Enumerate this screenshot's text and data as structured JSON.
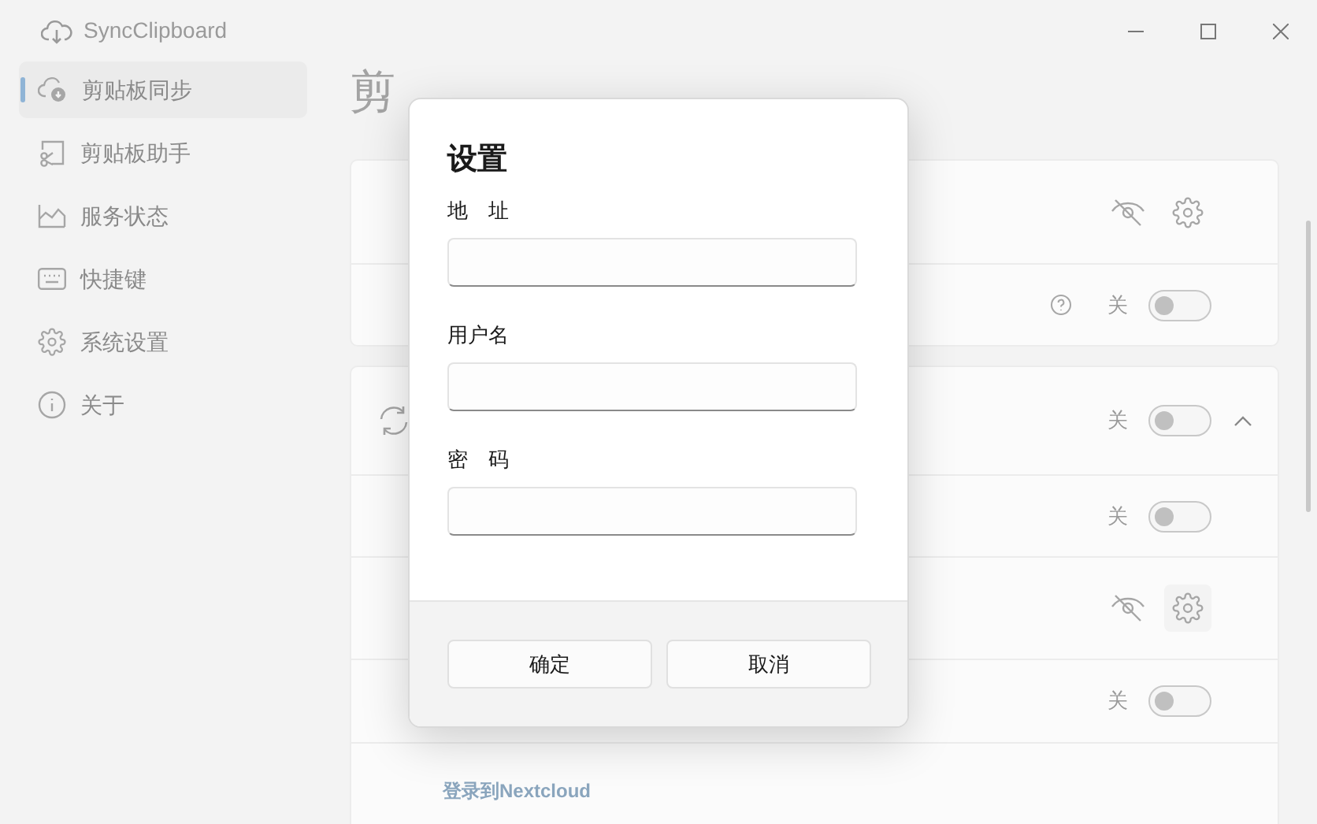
{
  "app": {
    "title": "SyncClipboard"
  },
  "sidebar": {
    "items": [
      {
        "label": "剪贴板同步",
        "selected": true
      },
      {
        "label": "剪贴板助手",
        "selected": false
      },
      {
        "label": "服务状态",
        "selected": false
      },
      {
        "label": "快捷键",
        "selected": false
      },
      {
        "label": "系统设置",
        "selected": false
      },
      {
        "label": "关于",
        "selected": false
      }
    ]
  },
  "page": {
    "title": "剪"
  },
  "cards": [
    {
      "rows": [
        {
          "kind": "actions"
        },
        {
          "kind": "toggle",
          "help": true,
          "state_label": "关",
          "on": false
        }
      ]
    },
    {
      "rows": [
        {
          "kind": "group",
          "state_label": "关",
          "on": false,
          "expanded": true
        },
        {
          "kind": "toggle",
          "help": false,
          "state_label": "关",
          "on": false
        },
        {
          "kind": "actions"
        },
        {
          "kind": "toggle",
          "help": false,
          "state_label": "关",
          "on": false
        },
        {
          "kind": "link",
          "text": "登录到Nextcloud"
        }
      ]
    }
  ],
  "dialog": {
    "title": "设置",
    "fields": [
      {
        "label": "地　址"
      },
      {
        "label": "用户名"
      },
      {
        "label": "密　码"
      }
    ],
    "buttons": [
      "确定",
      "取消"
    ]
  }
}
